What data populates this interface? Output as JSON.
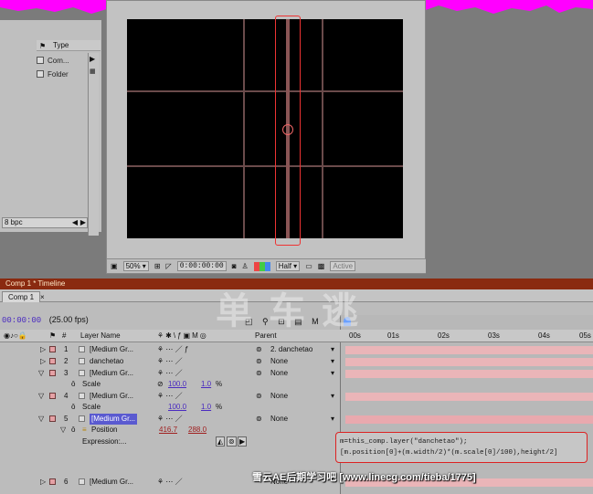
{
  "project_panel": {
    "column_type": "Type",
    "rows": [
      {
        "type": "Com..."
      },
      {
        "type": "Folder"
      }
    ],
    "bpc": "8 bpc"
  },
  "viewer": {
    "zoom": "50%",
    "timecode": "0:00:00:00",
    "resolution": "Half",
    "status": "Active"
  },
  "timeline": {
    "title": "Comp 1 * Timeline",
    "tab": "Comp 1",
    "time": "00:00:00",
    "fps": "(25.00 fps)",
    "columns": {
      "layer_name": "Layer Name",
      "parent": "Parent"
    },
    "ruler": [
      "00s",
      "01s",
      "02s",
      "03s",
      "04s",
      "05s"
    ],
    "layers": [
      {
        "num": "1",
        "name": "[Medium Gr...",
        "parent": "2. danchetao"
      },
      {
        "num": "2",
        "name": "danchetao",
        "parent": "None"
      },
      {
        "num": "3",
        "name": "[Medium Gr...",
        "parent": "None"
      },
      {
        "num": "4",
        "name": "[Medium Gr...",
        "parent": "None"
      },
      {
        "num": "5",
        "name": "[Medium Gr...",
        "parent": "None"
      },
      {
        "num": "6",
        "name": "[Medium Gr...",
        "parent": "None"
      }
    ],
    "scale_label": "Scale",
    "scale3": [
      "100.0",
      "1.0",
      "%"
    ],
    "scale4": [
      "100.0",
      "1.0",
      "%"
    ],
    "position_label": "Position",
    "position": [
      "416.7",
      "288.0"
    ],
    "expression_label": "Expression:...",
    "expression_line1": "m=this_comp.layer(\"danchetao\");",
    "expression_line2": "[m.position[0]+(m.width/2)*(m.scale[0]/100),height/2]"
  },
  "watermark": "单车逃",
  "footer_text": "雪云AE后期学习吧 [www.linecg.com/tieba/1775]",
  "colors": {
    "title_bar": "#8a2a10",
    "track": "#eab5b8",
    "highlight": "#e33333",
    "magenta": "#ff00ff"
  }
}
